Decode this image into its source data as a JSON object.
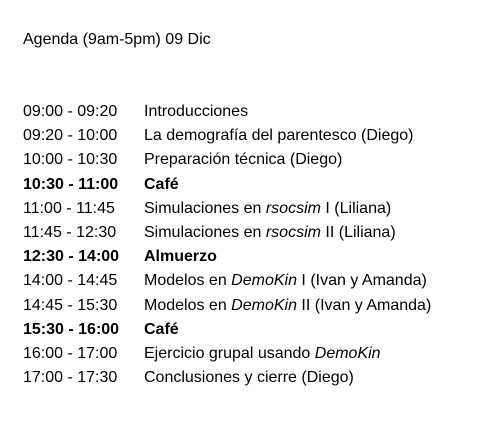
{
  "heading": "Agenda (9am-5pm) 09 Dic",
  "rows": [
    {
      "time": "09:00 - 09:20",
      "bold": false,
      "parts": [
        {
          "text": "Introducciones",
          "italic": false
        }
      ]
    },
    {
      "time": "09:20 - 10:00",
      "bold": false,
      "parts": [
        {
          "text": "La demografía del parentesco (Diego)",
          "italic": false
        }
      ]
    },
    {
      "time": "10:00 - 10:30",
      "bold": false,
      "parts": [
        {
          "text": "Preparación técnica (Diego)",
          "italic": false
        }
      ]
    },
    {
      "time": "10:30 - 11:00",
      "bold": true,
      "parts": [
        {
          "text": "Café",
          "italic": false
        }
      ]
    },
    {
      "time": "11:00 - 11:45",
      "bold": false,
      "parts": [
        {
          "text": "Simulaciones en ",
          "italic": false
        },
        {
          "text": "rsocsim",
          "italic": true
        },
        {
          "text": " I (Liliana)",
          "italic": false
        }
      ]
    },
    {
      "time": "11:45 - 12:30",
      "bold": false,
      "parts": [
        {
          "text": "Simulaciones en ",
          "italic": false
        },
        {
          "text": "rsocsim",
          "italic": true
        },
        {
          "text": " II (Liliana)",
          "italic": false
        }
      ]
    },
    {
      "time": "12:30 - 14:00",
      "bold": true,
      "parts": [
        {
          "text": "Almuerzo",
          "italic": false
        }
      ]
    },
    {
      "time": "14:00 - 14:45",
      "bold": false,
      "parts": [
        {
          "text": "Modelos en ",
          "italic": false
        },
        {
          "text": "DemoKin",
          "italic": true
        },
        {
          "text": " I (Ivan y Amanda)",
          "italic": false
        }
      ]
    },
    {
      "time": "14:45 - 15:30",
      "bold": false,
      "parts": [
        {
          "text": "Modelos en ",
          "italic": false
        },
        {
          "text": "DemoKin",
          "italic": true
        },
        {
          "text": " II (Ivan y Amanda)",
          "italic": false
        }
      ]
    },
    {
      "time": "15:30 - 16:00",
      "bold": true,
      "parts": [
        {
          "text": "Café",
          "italic": false
        }
      ]
    },
    {
      "time": "16:00 - 17:00",
      "bold": false,
      "parts": [
        {
          "text": "Ejercicio grupal usando ",
          "italic": false
        },
        {
          "text": "DemoKin",
          "italic": true
        }
      ]
    },
    {
      "time": "17:00 - 17:30",
      "bold": false,
      "parts": [
        {
          "text": "Conclusiones y cierre (Diego)",
          "italic": false
        }
      ]
    }
  ]
}
